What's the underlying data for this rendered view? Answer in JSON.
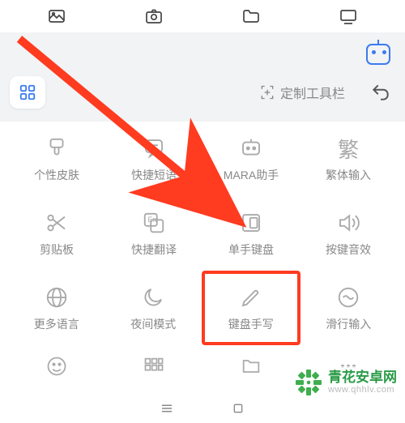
{
  "topbar": {
    "items": [
      "image",
      "camera",
      "folder",
      "monitor"
    ]
  },
  "toolbar": {
    "apps_icon": "apps-icon",
    "customize_label": "定制工具栏",
    "back_icon": "back-icon",
    "robot_icon": "robot-icon"
  },
  "grid": {
    "rows": [
      [
        {
          "icon": "brush",
          "label": "个性皮肤"
        },
        {
          "icon": "speech",
          "label": "快捷短语"
        },
        {
          "icon": "assistant",
          "label": "MARA助手"
        },
        {
          "icon": "traditional",
          "label": "繁体输入"
        }
      ],
      [
        {
          "icon": "scissors",
          "label": "剪贴板"
        },
        {
          "icon": "translate",
          "label": "快捷翻译"
        },
        {
          "icon": "one-hand",
          "label": "单手键盘"
        },
        {
          "icon": "speaker",
          "label": "按键音效"
        }
      ],
      [
        {
          "icon": "globe",
          "label": "更多语言"
        },
        {
          "icon": "moon",
          "label": "夜间模式"
        },
        {
          "icon": "pencil",
          "label": "键盘手写",
          "highlight": true
        },
        {
          "icon": "wave",
          "label": "滑行输入"
        }
      ],
      [
        {
          "icon": "face",
          "label": ""
        },
        {
          "icon": "keypad",
          "label": ""
        },
        {
          "icon": "folder-sm",
          "label": ""
        },
        {
          "icon": "dots",
          "label": ""
        }
      ]
    ]
  },
  "watermark": {
    "title": "青花安卓网",
    "url": "www.qhhlv.com"
  }
}
